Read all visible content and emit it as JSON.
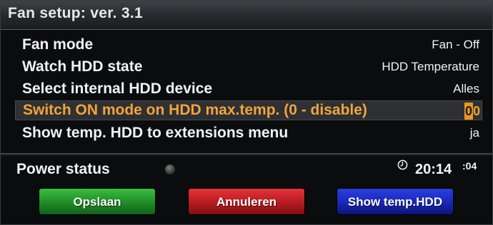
{
  "window": {
    "title": "Fan setup: ver. 3.1"
  },
  "settings": [
    {
      "label": "Fan mode",
      "value": "Fan - Off"
    },
    {
      "label": "Watch HDD state",
      "value": "HDD Temperature"
    },
    {
      "label": "Select internal HDD device",
      "value": "Alles"
    },
    {
      "label": "Switch ON mode on HDD max.temp. (0 - disable)",
      "value_cursor": "0",
      "value_rest": "0"
    },
    {
      "label": "Show temp. HDD to extensions menu",
      "value": "ja"
    }
  ],
  "status": {
    "label": "Power status",
    "led_color": "#5a625c"
  },
  "clock": {
    "icon": "clock-icon",
    "time": "20:14",
    "seconds": ":04"
  },
  "buttons": {
    "green": {
      "label": "Opslaan",
      "color": "#1f8c26"
    },
    "red": {
      "label": "Annuleren",
      "color": "#b51a20"
    },
    "blue": {
      "label": "Show temp.HDD",
      "color": "#1a27b6"
    }
  },
  "colors": {
    "accent": "#f2a43a",
    "cursor": "#e8981e",
    "text": "#f2f2f2"
  }
}
